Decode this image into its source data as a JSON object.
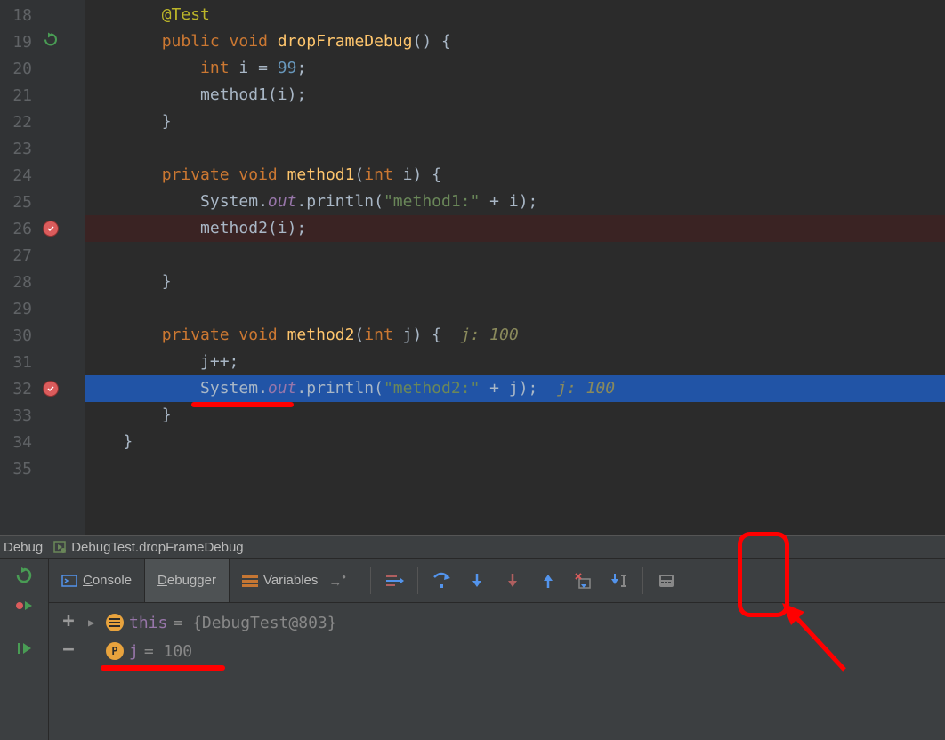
{
  "editor": {
    "lines": [
      {
        "n": 18,
        "html": "        <span class='an'>@Test</span>"
      },
      {
        "n": 19,
        "html": "        <span class='kw'>public void</span> <span class='mth'>dropFrameDebug</span>() {",
        "icon": "run"
      },
      {
        "n": 20,
        "html": "            <span class='kw'>int</span> i = <span class='num'>99</span>;"
      },
      {
        "n": 21,
        "html": "            method1(i);"
      },
      {
        "n": 22,
        "html": "        }"
      },
      {
        "n": 23,
        "html": ""
      },
      {
        "n": 24,
        "html": "        <span class='kw'>private void</span> <span class='mth'>method1</span>(<span class='kw'>int</span> i) {"
      },
      {
        "n": 25,
        "html": "            System.<span class='fld'>out</span>.println(<span class='str'>\"method1:\"</span> + i);"
      },
      {
        "n": 26,
        "html": "            method2(i);",
        "icon": "breakpoint",
        "bp": true
      },
      {
        "n": 27,
        "html": ""
      },
      {
        "n": 28,
        "html": "        }"
      },
      {
        "n": 29,
        "html": ""
      },
      {
        "n": 30,
        "html": "        <span class='kw'>private void</span> <span class='mth'>method2</span>(<span class='kw'>int</span> j) {  <span class='hint'>j: 100</span>"
      },
      {
        "n": 31,
        "html": "            j++;"
      },
      {
        "n": 32,
        "html": "            System.<span class='fld'>out</span>.println(<span class='str'>\"method2:\"</span> + j);  <span class='hint'>j: 100</span>",
        "icon": "breakpoint",
        "current": true
      },
      {
        "n": 33,
        "html": "        }"
      },
      {
        "n": 34,
        "html": "    }"
      },
      {
        "n": 35,
        "html": ""
      }
    ]
  },
  "debug_panel": {
    "title_label": "Debug",
    "run_config": "DebugTest.dropFrameDebug",
    "tabs": {
      "console": "Console",
      "debugger": "Debugger",
      "variables": "Variables"
    },
    "variables": [
      {
        "expandable": true,
        "badge": "f",
        "name": "this",
        "value": "= {DebugTest@803}"
      },
      {
        "expandable": false,
        "badge": "P",
        "name": "j",
        "value": "= 100"
      }
    ]
  }
}
